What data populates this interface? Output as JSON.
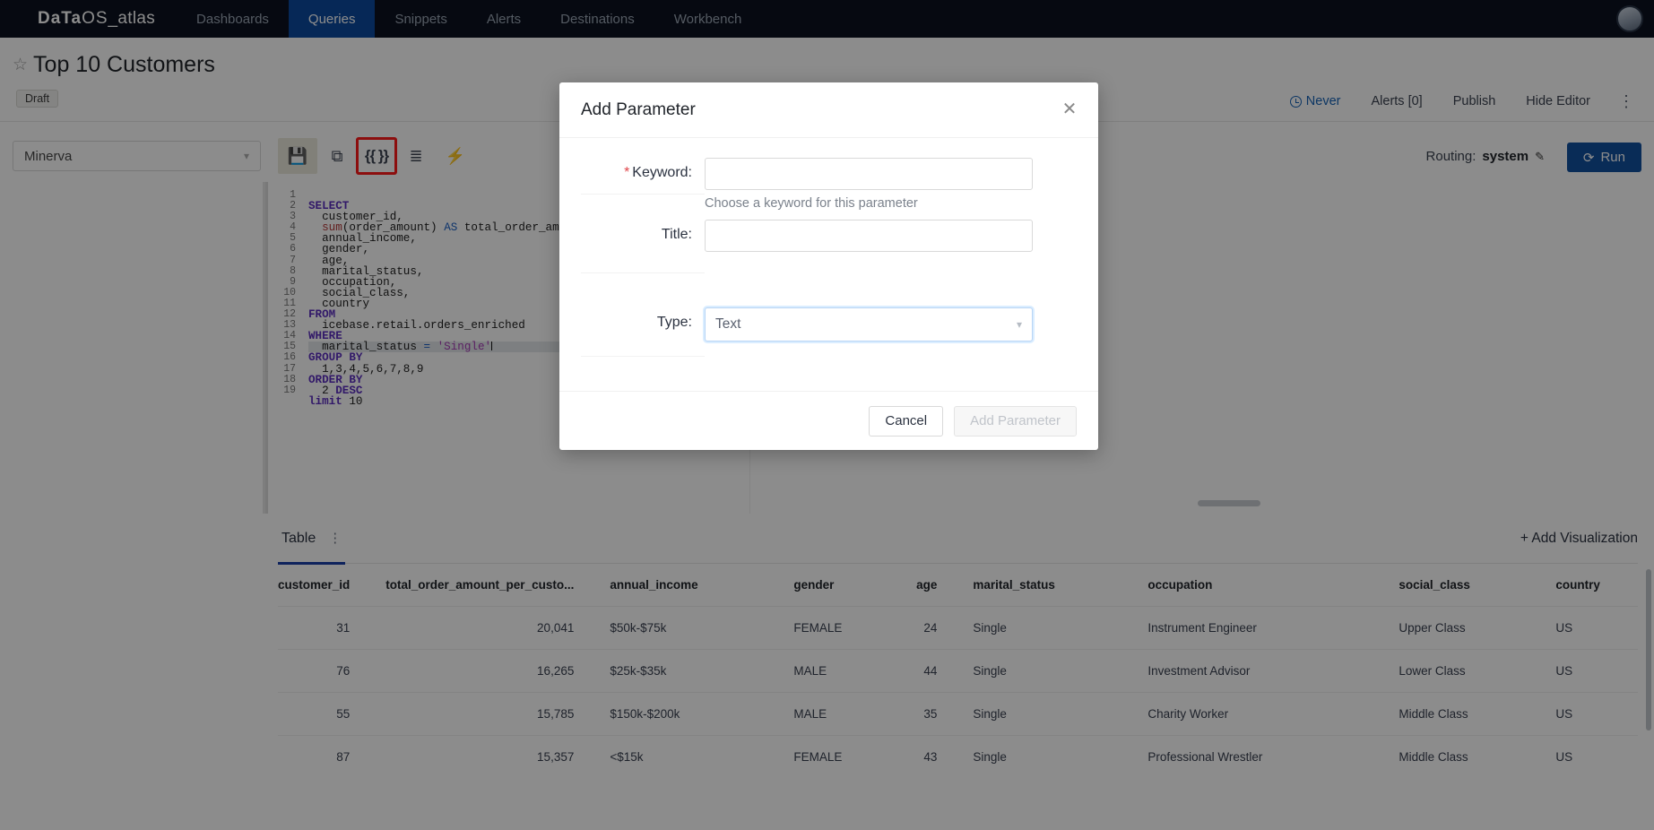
{
  "nav": {
    "brand_part1": "DaTa",
    "brand_part2": "OS",
    "brand_part3": "_atlas",
    "items": [
      {
        "label": "Dashboards",
        "active": false
      },
      {
        "label": "Queries",
        "active": true
      },
      {
        "label": "Snippets",
        "active": false
      },
      {
        "label": "Alerts",
        "active": false
      },
      {
        "label": "Destinations",
        "active": false
      },
      {
        "label": "Workbench",
        "active": false
      }
    ],
    "avatar_icon": "user-avatar-icon"
  },
  "header": {
    "star_icon": "star-outline-icon",
    "title": "Top 10 Customers",
    "status_badge": "Draft",
    "schedule_label": "Never",
    "clock_icon": "clock-icon",
    "alerts_label": "Alerts [0]",
    "publish_label": "Publish",
    "hide_editor_label": "Hide Editor",
    "kebab_icon": "more-vertical-icon"
  },
  "toolbar": {
    "datasource_value": "Minerva",
    "datasource_chevron_icon": "chevron-down-icon",
    "buttons": [
      {
        "icon": "save-icon",
        "glyph": "💾",
        "name": "save-query-button"
      },
      {
        "icon": "copy-icon",
        "glyph": "⧉",
        "name": "fork-query-button"
      },
      {
        "icon": "parameter-braces-icon",
        "glyph": "{{ }}",
        "name": "add-parameter-button"
      },
      {
        "icon": "format-indent-icon",
        "glyph": "☰",
        "name": "format-query-button"
      },
      {
        "icon": "lightning-icon",
        "glyph": "⚡",
        "name": "autocomplete-toggle-button"
      }
    ],
    "routing_prefix": "Routing:",
    "routing_value": "system",
    "routing_edit_icon": "pencil-icon",
    "run_label": "Run",
    "run_icon": "refresh-icon"
  },
  "editor": {
    "line_numbers": [
      "1",
      "2",
      "3",
      "4",
      "5",
      "6",
      "7",
      "8",
      "9",
      "10",
      "11",
      "12",
      "13",
      "14",
      "15",
      "16",
      "17",
      "18",
      "19"
    ],
    "current_line": 14,
    "code_lines": [
      "SELECT",
      "  customer_id,",
      "  sum(order_amount) AS total_order_amount_per_",
      "  annual_income,",
      "  gender,",
      "  age,",
      "  marital_status,",
      "  occupation,",
      "  social_class,",
      "  country",
      "FROM",
      "  icebase.retail.orders_enriched",
      "WHERE",
      "  marital_status = 'Single'",
      "GROUP BY",
      "  1,3,4,5,6,7,8,9",
      "ORDER BY",
      "  2 DESC",
      "limit 10"
    ]
  },
  "results": {
    "tab_label": "Table",
    "tab_menu_icon": "more-vertical-icon",
    "add_visualization_label": "+ Add Visualization",
    "columns": [
      "customer_id",
      "total_order_amount_per_custo...",
      "annual_income",
      "gender",
      "age",
      "marital_status",
      "occupation",
      "social_class",
      "country"
    ],
    "rows": [
      [
        "31",
        "20,041",
        "$50k-$75k",
        "FEMALE",
        "24",
        "Single",
        "Instrument Engineer",
        "Upper Class",
        "US"
      ],
      [
        "76",
        "16,265",
        "$25k-$35k",
        "MALE",
        "44",
        "Single",
        "Investment Advisor",
        "Lower Class",
        "US"
      ],
      [
        "55",
        "15,785",
        "$150k-$200k",
        "MALE",
        "35",
        "Single",
        "Charity Worker",
        "Middle Class",
        "US"
      ],
      [
        "87",
        "15,357",
        "<$15k",
        "FEMALE",
        "43",
        "Single",
        "Professional Wrestler",
        "Middle Class",
        "US"
      ]
    ]
  },
  "modal": {
    "title": "Add Parameter",
    "close_icon": "close-icon",
    "keyword_label": "Keyword:",
    "keyword_required_marker": "*",
    "keyword_value": "",
    "keyword_help": "Choose a keyword for this parameter",
    "title_label": "Title:",
    "title_value": "",
    "type_label": "Type:",
    "type_value": "Text",
    "type_chevron_icon": "chevron-down-icon",
    "cancel_label": "Cancel",
    "submit_label": "Add Parameter"
  },
  "colors": {
    "nav_bg": "#0b1220",
    "nav_active": "#0b4a9e",
    "accent": "#11509f",
    "link": "#1763b6",
    "tab_underline": "#1b3fa8",
    "required": "#e0474c",
    "highlight_outline": "#ff1a1a"
  }
}
